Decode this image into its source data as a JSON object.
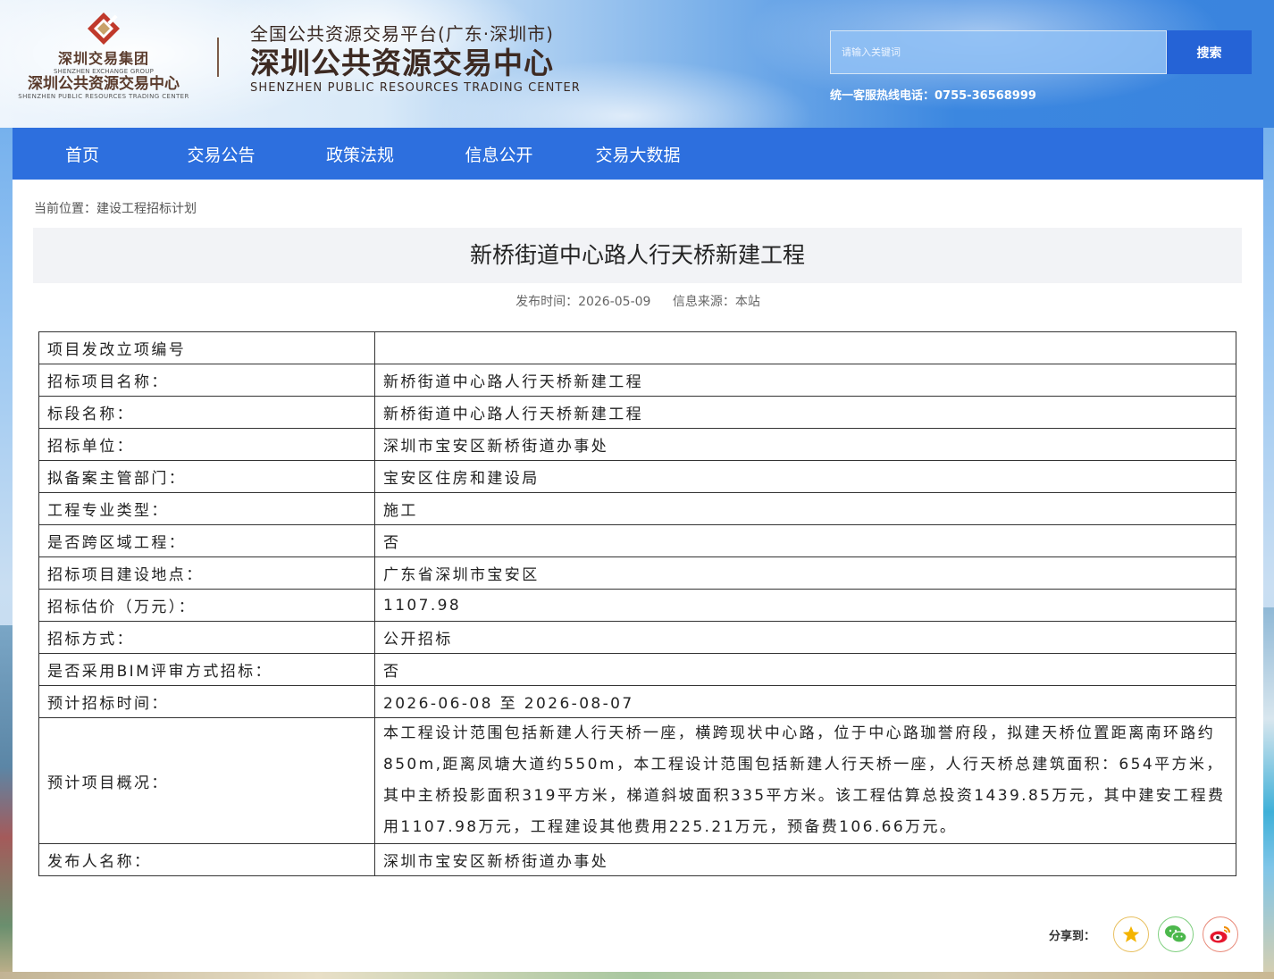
{
  "colors": {
    "nav_bg": "#2d6fde",
    "search_button": "#2563d6",
    "logo_brown": "#5a3b2c"
  },
  "logo": {
    "group_cn": "深圳交易集团",
    "group_en": "SHENZHEN EXCHANGE GROUP",
    "center_cn": "深圳公共资源交易中心",
    "center_en": "SHENZHEN PUBLIC RESOURCES TRADING CENTER"
  },
  "platform": {
    "line1": "全国公共资源交易平台(广东·深圳市)",
    "line2": "深圳公共资源交易中心",
    "line3": "SHENZHEN PUBLIC RESOURCES TRADING CENTER"
  },
  "search": {
    "placeholder": "请输入关键词",
    "button": "搜索"
  },
  "hotline": "统一客服热线电话：0755-36568999",
  "nav": [
    "首页",
    "交易公告",
    "政策法规",
    "信息公开",
    "交易大数据"
  ],
  "breadcrumb": "当前位置：建设工程招标计划",
  "article": {
    "title": "新桥街道中心路人行天桥新建工程",
    "publish_time": "发布时间：2026-05-09",
    "source": "信息来源：本站"
  },
  "table": [
    {
      "k": "项目发改立项编号",
      "v": ""
    },
    {
      "k": "招标项目名称：",
      "v": "新桥街道中心路人行天桥新建工程"
    },
    {
      "k": "标段名称：",
      "v": "新桥街道中心路人行天桥新建工程"
    },
    {
      "k": "招标单位：",
      "v": "深圳市宝安区新桥街道办事处"
    },
    {
      "k": "拟备案主管部门：",
      "v": "宝安区住房和建设局"
    },
    {
      "k": "工程专业类型：",
      "v": "施工"
    },
    {
      "k": "是否跨区域工程：",
      "v": "否"
    },
    {
      "k": "招标项目建设地点：",
      "v": "广东省深圳市宝安区"
    },
    {
      "k": "招标估价（万元）：",
      "v": "1107.98"
    },
    {
      "k": "招标方式：",
      "v": "公开招标"
    },
    {
      "k": "是否采用BIM评审方式招标：",
      "v": "否"
    },
    {
      "k": "预计招标时间：",
      "v": "2026-06-08 至 2026-08-07"
    },
    {
      "k": "预计项目概况：",
      "v": "本工程设计范围包括新建人行天桥一座，横跨现状中心路，位于中心路珈誉府段，拟建天桥位置距离南环路约850m,距离凤塘大道约550m，本工程设计范围包括新建人行天桥一座，人行天桥总建筑面积：654平方米，其中主桥投影面积319平方米，梯道斜坡面积335平方米。该工程估算总投资1439.85万元，其中建安工程费用1107.98万元，工程建设其他费用225.21万元，预备费106.66万元。"
    },
    {
      "k": "发布人名称：",
      "v": "深圳市宝安区新桥街道办事处"
    }
  ],
  "share": {
    "label": "分享到：",
    "icons": [
      "star-icon",
      "wechat-icon",
      "weibo-icon"
    ]
  }
}
